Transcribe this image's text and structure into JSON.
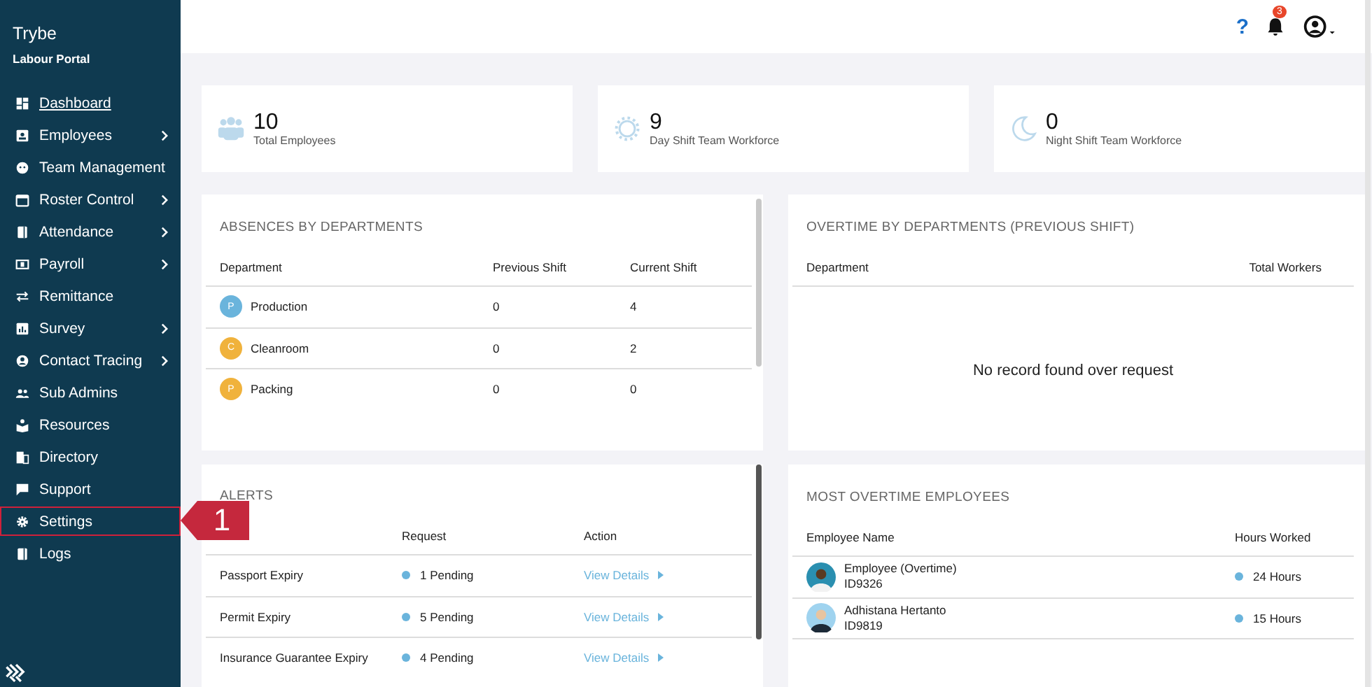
{
  "brand": {
    "title": "Trybe",
    "subtitle": "Labour Portal"
  },
  "sidebar": {
    "items": [
      {
        "label": "Dashboard",
        "submenu": false,
        "selected": true,
        "outlined": false
      },
      {
        "label": "Employees",
        "submenu": true,
        "selected": false,
        "outlined": false
      },
      {
        "label": "Team Management",
        "submenu": false,
        "selected": false,
        "outlined": false
      },
      {
        "label": "Roster Control",
        "submenu": true,
        "selected": false,
        "outlined": false
      },
      {
        "label": "Attendance",
        "submenu": true,
        "selected": false,
        "outlined": false
      },
      {
        "label": "Payroll",
        "submenu": true,
        "selected": false,
        "outlined": false
      },
      {
        "label": "Remittance",
        "submenu": false,
        "selected": false,
        "outlined": false
      },
      {
        "label": "Survey",
        "submenu": true,
        "selected": false,
        "outlined": false
      },
      {
        "label": "Contact Tracing",
        "submenu": true,
        "selected": false,
        "outlined": false
      },
      {
        "label": "Sub Admins",
        "submenu": false,
        "selected": false,
        "outlined": false
      },
      {
        "label": "Resources",
        "submenu": false,
        "selected": false,
        "outlined": false
      },
      {
        "label": "Directory",
        "submenu": false,
        "selected": false,
        "outlined": false
      },
      {
        "label": "Support",
        "submenu": false,
        "selected": false,
        "outlined": false
      },
      {
        "label": "Settings",
        "submenu": false,
        "selected": false,
        "outlined": true
      },
      {
        "label": "Logs",
        "submenu": false,
        "selected": false,
        "outlined": false
      }
    ]
  },
  "callout": {
    "label": "1"
  },
  "topbar": {
    "help": "?",
    "notifications": "3"
  },
  "stats": [
    {
      "value": "10",
      "label": "Total Employees"
    },
    {
      "value": "9",
      "label": "Day Shift Team Workforce"
    },
    {
      "value": "0",
      "label": "Night Shift Team Workforce"
    }
  ],
  "absences": {
    "title": "ABSENCES BY DEPARTMENTS",
    "columns": [
      "Department",
      "Previous Shift",
      "Current Shift"
    ],
    "rows": [
      {
        "initial": "P",
        "color": "#6ab4dc",
        "department": "Production",
        "previous": "0",
        "current": "4"
      },
      {
        "initial": "C",
        "color": "#f0b23c",
        "department": "Cleanroom",
        "previous": "0",
        "current": "2"
      },
      {
        "initial": "P",
        "color": "#f0b23c",
        "department": "Packing",
        "previous": "0",
        "current": "0"
      }
    ]
  },
  "overtime_departments": {
    "title": "OVERTIME BY DEPARTMENTS (PREVIOUS SHIFT)",
    "columns": [
      "Department",
      "Total Workers"
    ],
    "empty": "No record found over request"
  },
  "alerts": {
    "title": "ALERTS",
    "columns": [
      "Request",
      "Action"
    ],
    "rows": [
      {
        "name": "Passport Expiry",
        "request": "1 Pending",
        "action": "View Details"
      },
      {
        "name": "Permit Expiry",
        "request": "5 Pending",
        "action": "View Details"
      },
      {
        "name": "Insurance Guarantee Expiry",
        "request": "4 Pending",
        "action": "View Details"
      }
    ]
  },
  "overtime_employees": {
    "title": "MOST OVERTIME EMPLOYEES",
    "columns": [
      "Employee Name",
      "Hours Worked"
    ],
    "rows": [
      {
        "name": "Employee (Overtime)",
        "id": "ID9326",
        "hours": "24 Hours"
      },
      {
        "name": "Adhistana Hertanto",
        "id": "ID9819",
        "hours": "15 Hours"
      }
    ]
  }
}
